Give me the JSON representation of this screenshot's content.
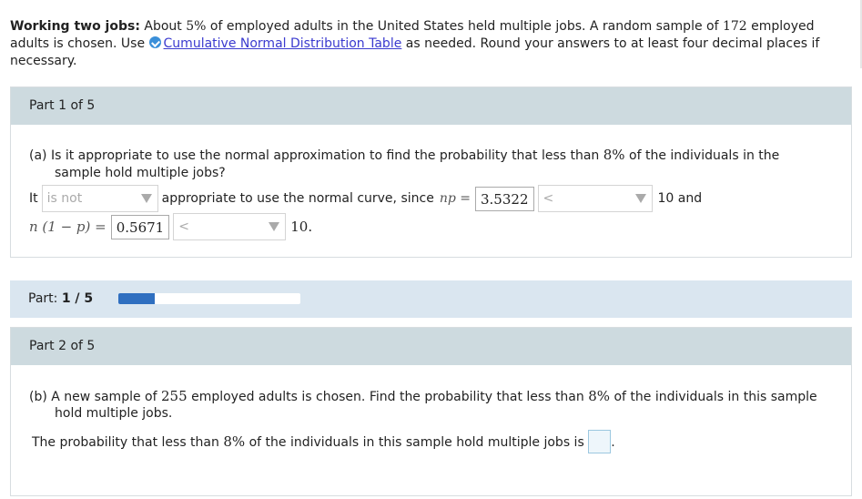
{
  "intro": {
    "bold_title": "Working two jobs:",
    "text1": " About ",
    "pct1": "5%",
    "text2": " of employed adults in the United States held multiple jobs. A random sample of ",
    "n1": "172",
    "text3": " employed adults is chosen. Use ",
    "link": "Cumulative Normal Distribution Table",
    "text4": " as needed. Round your answers to at least four decimal places if necessary."
  },
  "part1": {
    "header": "Part 1 of 5",
    "question_label": "(a)",
    "question_text_a": "Is it appropriate to use the normal approximation to find the probability that less than ",
    "question_pct": "8%",
    "question_text_b": " of the individuals in the",
    "question_text_c": "sample hold multiple jobs?",
    "it_label": "It",
    "dropdown1_value": "is not",
    "line1_mid": "appropriate to use the normal curve, since",
    "np_label": "np =",
    "np_value": "3.5322",
    "dropdown2_value": "<",
    "line1_end": "10 and",
    "nq_label": "n (1 − p) =",
    "nq_value": "0.5671",
    "dropdown3_value": "<",
    "line2_end": "10."
  },
  "progress": {
    "label": "Part:",
    "value": "1 / 5",
    "fraction": 0.2
  },
  "part2": {
    "header": "Part 2 of 5",
    "question_label": "(b)",
    "text_a": "A new sample of ",
    "n2": "255",
    "text_b": " employed adults is chosen. Find the probability that less than ",
    "pct": "8%",
    "text_c": " of the individuals in this sample",
    "text_d": "hold multiple jobs.",
    "answer_a": "The probability that less than ",
    "answer_pct": "8%",
    "answer_b": " of the individuals in this sample hold multiple jobs is"
  }
}
